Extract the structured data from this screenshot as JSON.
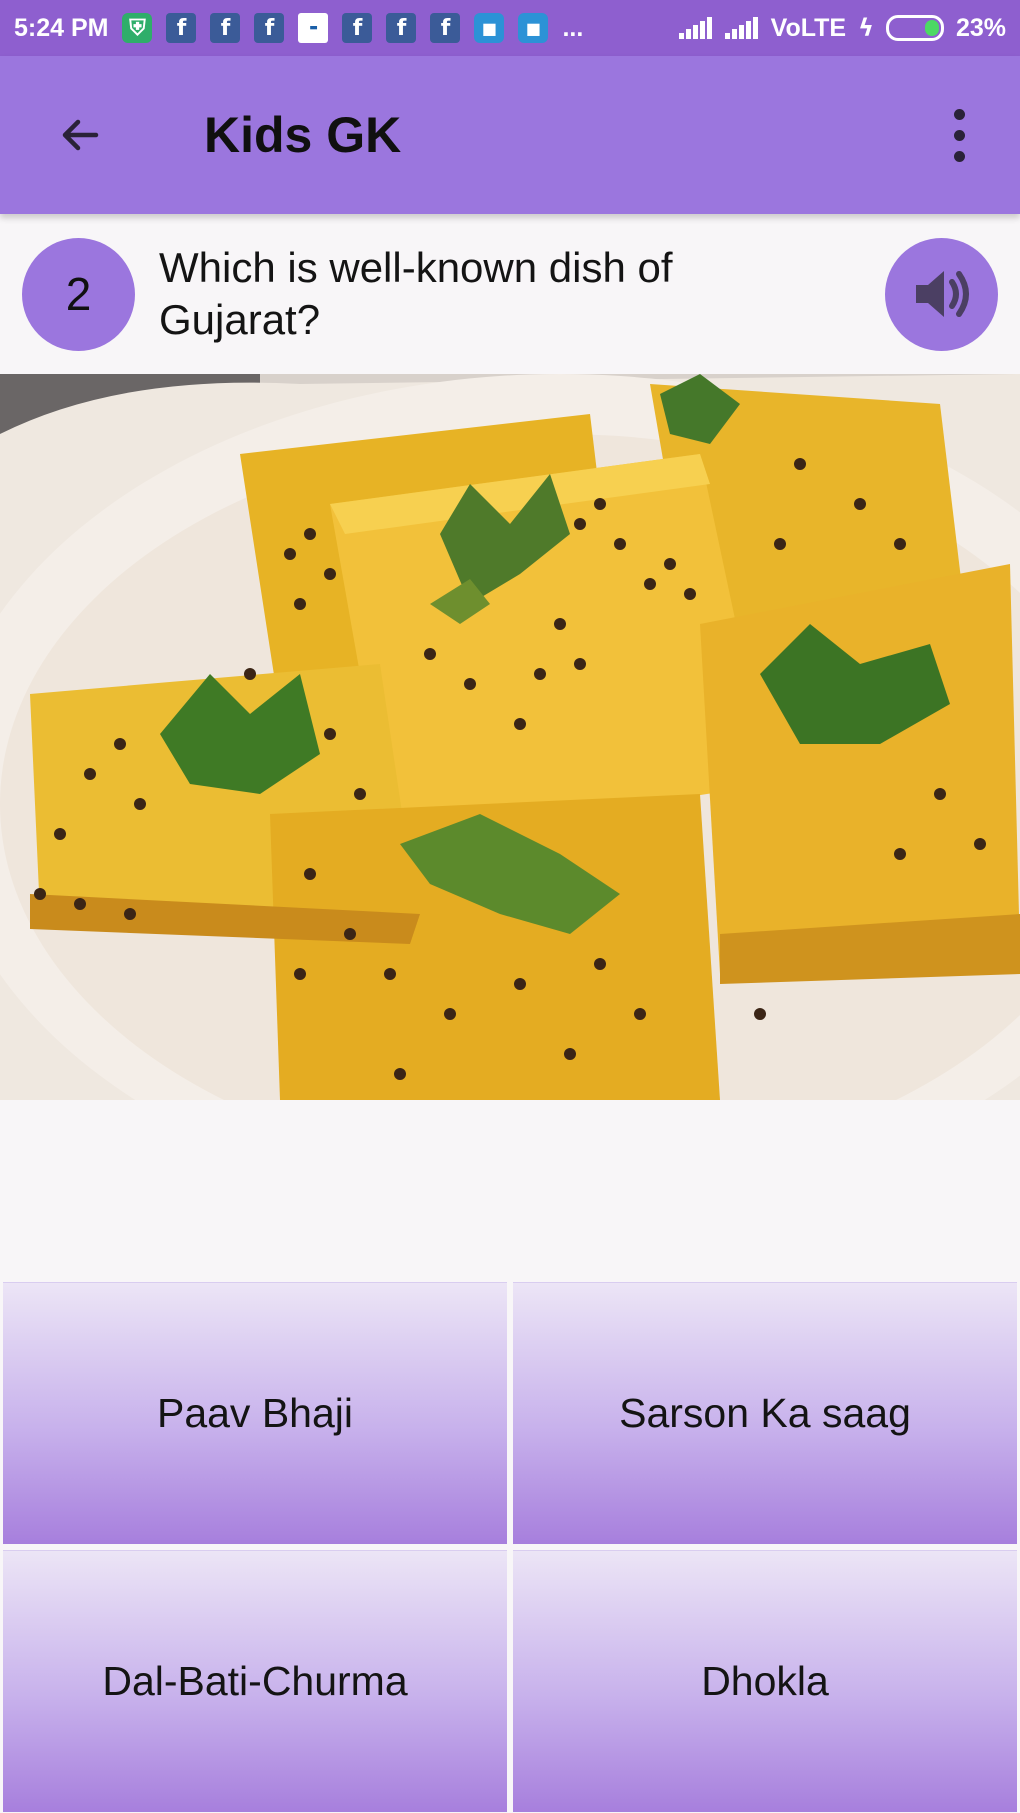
{
  "status_bar": {
    "time": "5:24 PM",
    "network": "VoLTE",
    "battery": "23%",
    "more_indicator": "..."
  },
  "app_bar": {
    "title": "Kids GK"
  },
  "question": {
    "number": "2",
    "text": "Which is well-known dish of Gujarat?"
  },
  "answers": [
    {
      "label": "Paav Bhaji"
    },
    {
      "label": "Sarson Ka saag"
    },
    {
      "label": "Dal-Bati-Churma"
    },
    {
      "label": "Dhokla"
    }
  ],
  "icons": {
    "back": "arrow-back-icon",
    "menu": "more-vert-icon",
    "speaker": "volume-icon"
  },
  "colors": {
    "accent": "#9b76de",
    "status_bar": "#8e5fcf"
  }
}
